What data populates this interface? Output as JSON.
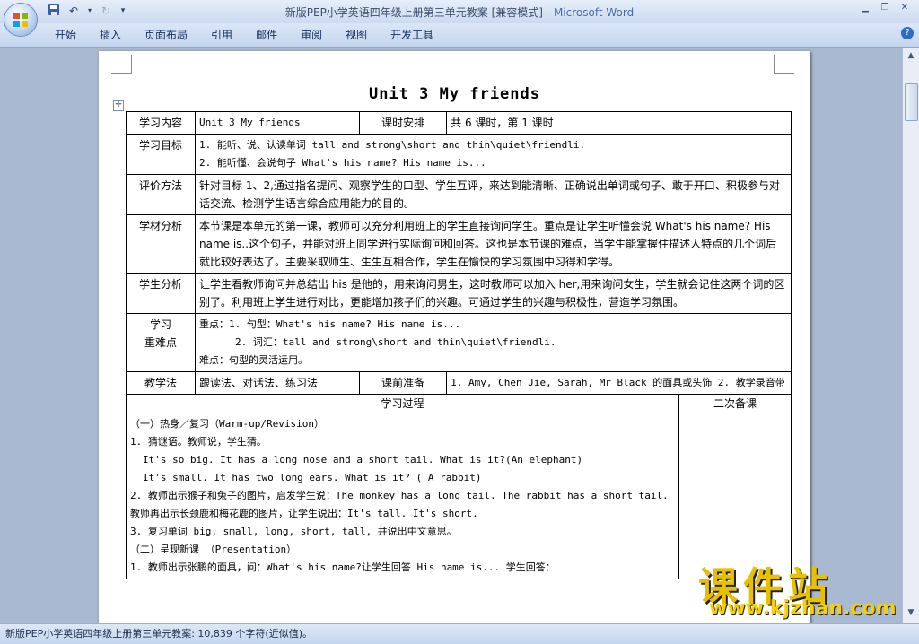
{
  "window": {
    "doc_name": "新版PEP小学英语四年级上册第三单元教案 [兼容模式]",
    "separator": " - ",
    "app": "Microsoft Word"
  },
  "ribbon": {
    "tabs": [
      "开始",
      "插入",
      "页面布局",
      "引用",
      "邮件",
      "审阅",
      "视图",
      "开发工具"
    ]
  },
  "doc": {
    "title": "Unit 3 My friends",
    "rows": {
      "content_label": "学习内容",
      "content_value": "Unit 3 My friends",
      "schedule_label": "课时安排",
      "schedule_value": "共 6 课时，第 1 课时",
      "goal_label": "学习目标",
      "goal_1": "1. 能听、说、认读单词 tall and strong\\short and thin\\quiet\\friendli.",
      "goal_2": "2. 能听懂、会说句子 What's his name? His name is...",
      "eval_label": "评价方法",
      "eval_value": "针对目标 1、2,通过指名提问、观察学生的口型、学生互评，来达到能清晰、正确说出单词或句子、敢于开口、积极参与对话交流、检测学生语言综合应用能力的目的。",
      "material_label": "学材分析",
      "material_value": "本节课是本单元的第一课，教师可以充分利用班上的学生直接询问学生。重点是让学生听懂会说 What's his name? His name is..这个句子，并能对班上同学进行实际询问和回答。这也是本节课的难点，当学生能掌握住描述人特点的几个词后就比较好表达了。主要采取师生、生生互相合作，学生在愉快的学习氛围中习得和学得。",
      "student_label": "学生分析",
      "student_value": "让学生看教师询问并总结出 his 是他的，用来询问男生，这时教师可以加入 her,用来询问女生，学生就会记住这两个词的区别了。利用班上学生进行对比，更能增加孩子们的兴趣。可通过学生的兴趣与积极性，营造学习氛围。",
      "key_label_1": "学习",
      "key_label_2": "重难点",
      "key_1": "重点：1. 句型：What's his name? His name is...",
      "key_2": "2. 词汇：tall and strong\\short and thin\\quiet\\friendli.",
      "key_3": "难点：句型的灵活运用。",
      "method_label": "教学法",
      "method_value": "跟读法、对话法、练习法",
      "prep_label": "课前准备",
      "prep_value": "1. Amy, Chen Jie, Sarah, Mr Black 的面具或头饰 2. 教学录音带",
      "process_label": "学习过程",
      "backup_label": "二次备课"
    },
    "process": [
      "（一）热身／复习（Warm-up/Revision）",
      "1. 猜谜语。教师说，学生猜。",
      "It's so big. It has a long nose and a short tail. What is it?(An elephant)",
      "It's small. It has two long ears. What is it? ( A rabbit)",
      "2.  教师出示猴子和兔子的图片，启发学生说：The monkey has a long tail. The rabbit has a short tail. 教师再出示长颈鹿和梅花鹿的图片，让学生说出：It's tall. It's short.",
      "3. 复习单词 big, small, long, short, tall, 并说出中文意思。",
      "（二）呈现新课 （Presentation）",
      "1.  教师出示张鹏的面具，问：What's his name?让学生回答 His name is...      学生回答："
    ]
  },
  "status_bar": {
    "text": "新版PEP小学英语四年级上册第三单元教案: 10,839 个字符(近似值)。"
  },
  "watermark": {
    "brand": "课件站",
    "url": "www.kjzhan.com"
  },
  "icons": [
    "save-icon",
    "undo-icon",
    "redo-icon",
    "customize-qat-icon",
    "minimize-icon",
    "restore-icon",
    "close-icon",
    "help-icon",
    "table-move-handle-icon"
  ]
}
